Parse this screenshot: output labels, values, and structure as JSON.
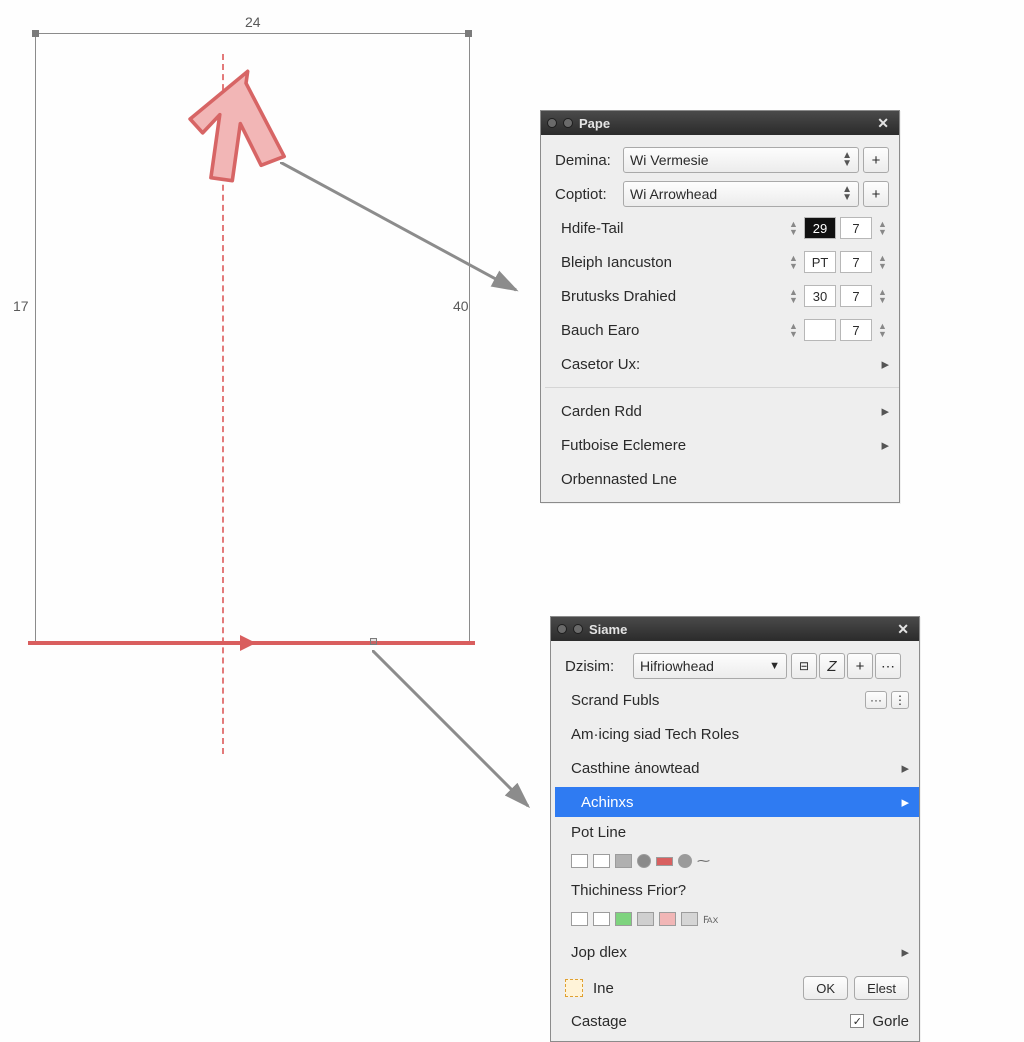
{
  "canvas": {
    "top_dimension": "24",
    "left_dimension": "17",
    "mid_dimension": "40",
    "arrow_fill": "#f2b6b6",
    "arrow_stroke": "#d76565",
    "line_color": "#d95e5e",
    "guide_color": "#e37a7a"
  },
  "dialog1": {
    "title": "Pape",
    "rows": {
      "demina": {
        "label": "Demina:",
        "value": "Wi Vermesie"
      },
      "coptiot": {
        "label": "Coptiot:",
        "value": "Wi Arrowhead"
      },
      "hdife": {
        "label": "Hdife-Tail",
        "v1": "29",
        "v2": "7"
      },
      "bleiph": {
        "label": "Bleiph Iancuston",
        "v1": "PT",
        "v2": "7"
      },
      "brutusks": {
        "label": "Brutusks Drahied",
        "v1": "30",
        "v2": "7"
      },
      "bauch": {
        "label": "Bauch Earo",
        "v1": "",
        "v2": "7"
      },
      "casetor": {
        "label": "Casetor Ux:"
      },
      "carden": {
        "label": "Carden Rdd"
      },
      "futboise": {
        "label": "Futboise Eclemere"
      },
      "orben": {
        "label": "Orbennasted Lne"
      }
    }
  },
  "dialog2": {
    "title": "Siame",
    "design_label": "Dzisim:",
    "design_value": "Hifriowhead",
    "items": {
      "scrand": "Scrand Fubls",
      "amicing": "Am·icing siad Tech Roles",
      "casthine": "Casthine ȧnowtead",
      "achinxs": "Achinxs",
      "potline": "Pot Line",
      "thick": "Thichiness Frior?",
      "jopdlex": "Jop dlex"
    },
    "ine_label": "Ine",
    "castage_label": "Castage",
    "gorle_label": "Gorle",
    "ok_label": "OK",
    "elest_label": "Elest",
    "swatch_colors": [
      "#ffffff",
      "#ffffff",
      "#b0b0b0",
      "#8a8a8a",
      "#d86060",
      "#9a9a9a"
    ],
    "thick_colors": [
      "#ffffff",
      "#ffffff",
      "#7ed37e",
      "#cfcfcf",
      "#f1b6b6",
      "#d5d5d5"
    ],
    "scrand_buttons": [
      "···",
      "⋮"
    ]
  }
}
